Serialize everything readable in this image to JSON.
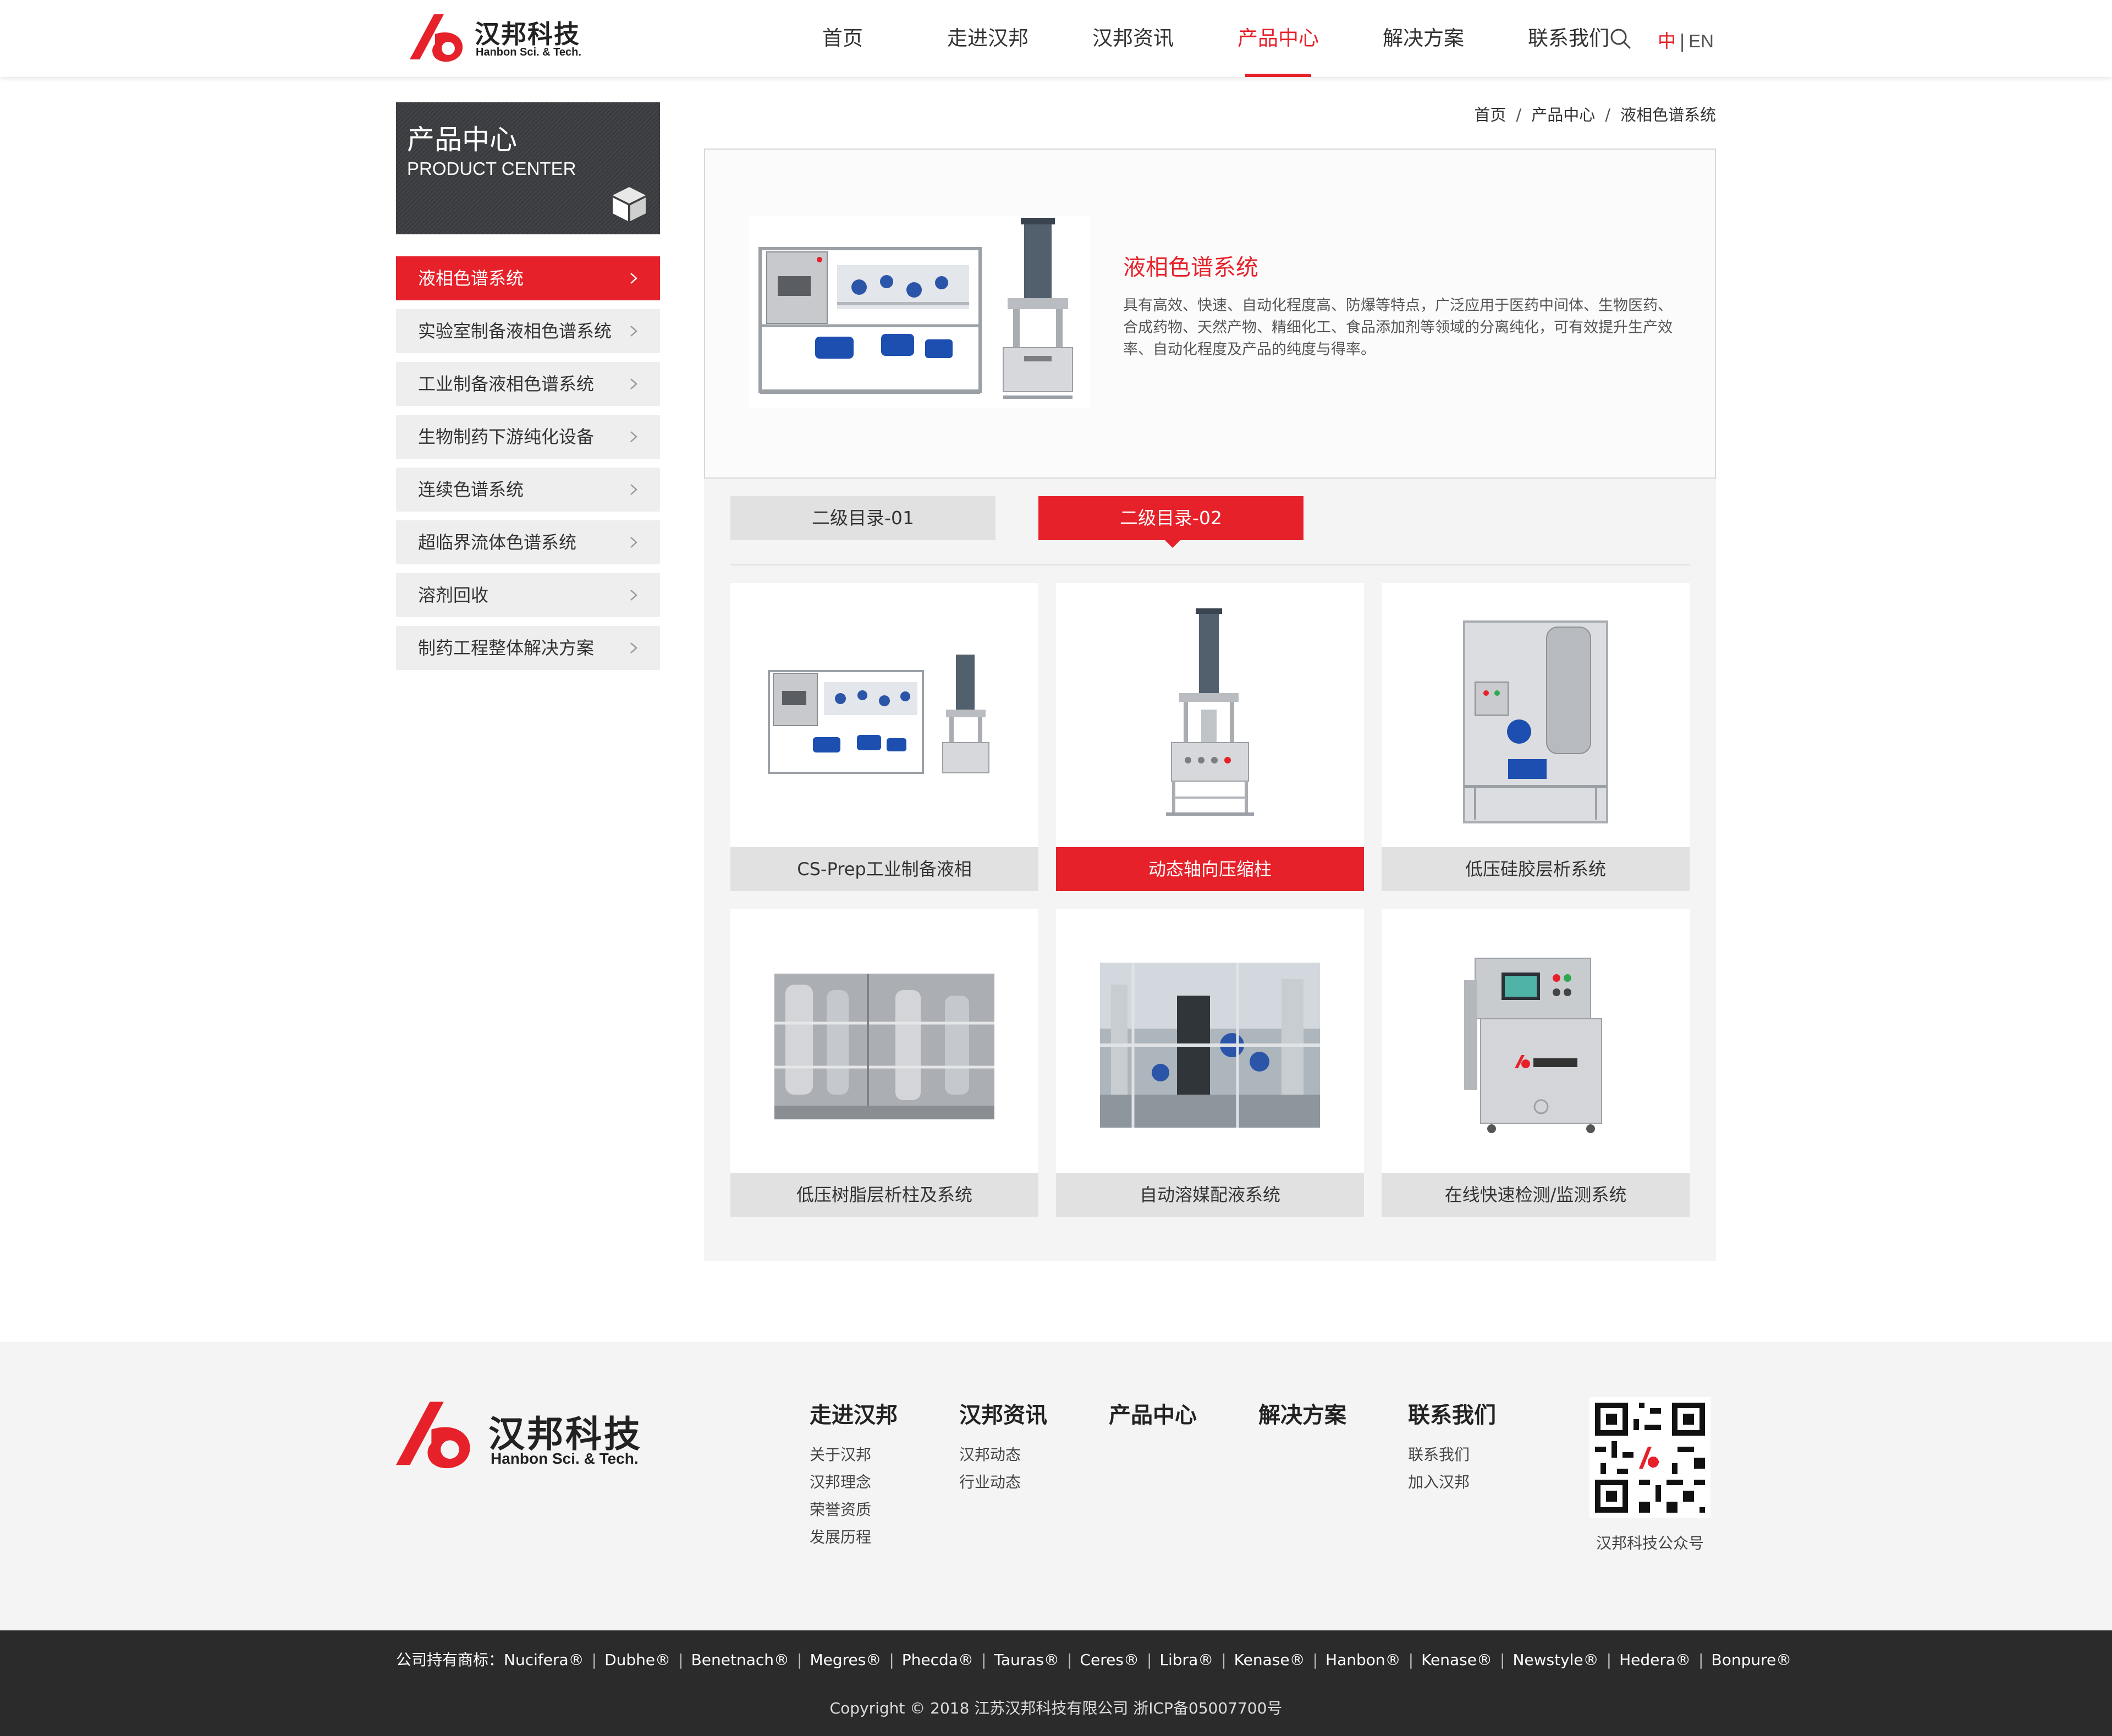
{
  "brand": {
    "name_cn": "汉邦科技",
    "name_en": "Hanbon Sci. & Tech.",
    "accent": "#e6212a"
  },
  "nav": {
    "items": [
      {
        "label": "首页"
      },
      {
        "label": "走进汉邦"
      },
      {
        "label": "汉邦资讯"
      },
      {
        "label": "产品中心",
        "active": true
      },
      {
        "label": "解决方案"
      },
      {
        "label": "联系我们"
      }
    ],
    "search_icon": "search-icon",
    "lang_zh": "中",
    "lang_sep": "|",
    "lang_en": "EN"
  },
  "sidebar": {
    "title_cn": "产品中心",
    "title_en": "PRODUCT CENTER",
    "items": [
      {
        "label": "液相色谱系统",
        "active": true
      },
      {
        "label": "实验室制备液相色谱系统"
      },
      {
        "label": "工业制备液相色谱系统"
      },
      {
        "label": "生物制药下游纯化设备"
      },
      {
        "label": "连续色谱系统"
      },
      {
        "label": "超临界流体色谱系统"
      },
      {
        "label": "溶剂回收"
      },
      {
        "label": "制药工程整体解决方案"
      }
    ]
  },
  "breadcrumb": {
    "items": [
      "首页",
      "产品中心",
      "液相色谱系统"
    ],
    "separator": "/"
  },
  "feature": {
    "title": "液相色谱系统",
    "description": "具有高效、快速、自动化程度高、防爆等特点，广泛应用于医药中间体、生物医药、合成药物、天然产物、精细化工、食品添加剂等领域的分离纯化，可有效提升生产效率、自动化程度及产品的纯度与得率。"
  },
  "tabs": [
    {
      "label": "二级目录-01"
    },
    {
      "label": "二级目录-02",
      "active": true
    }
  ],
  "products": [
    {
      "label": "CS-Prep工业制备液相"
    },
    {
      "label": "动态轴向压缩柱",
      "active": true
    },
    {
      "label": "低压硅胶层析系统"
    },
    {
      "label": "低压树脂层析柱及系统"
    },
    {
      "label": "自动溶媒配液系统"
    },
    {
      "label": "在线快速检测/监测系统"
    }
  ],
  "footer": {
    "columns": [
      {
        "title": "走进汉邦",
        "links": [
          "关于汉邦",
          "汉邦理念",
          "荣誉资质",
          "发展历程"
        ]
      },
      {
        "title": "汉邦资讯",
        "links": [
          "汉邦动态",
          "行业动态"
        ]
      },
      {
        "title": "产品中心",
        "links": []
      },
      {
        "title": "解决方案",
        "links": []
      },
      {
        "title": "联系我们",
        "links": [
          "联系我们",
          "加入汉邦"
        ]
      }
    ],
    "qr_label": "汉邦科技公众号",
    "trademarks_prefix": "公司持有商标：",
    "trademarks": [
      "Nucifera®",
      "Dubhe®",
      "Benetnach®",
      "Megres®",
      "Phecda®",
      "Tauras®",
      "Ceres®",
      "Libra®",
      "Kenase®",
      "Hanbon®",
      "Kenase®",
      "Newstyle®",
      "Hedera®",
      "Bonpure®"
    ],
    "copyright": "Copyright © 2018 江苏汉邦科技有限公司 浙ICP备05007700号"
  }
}
